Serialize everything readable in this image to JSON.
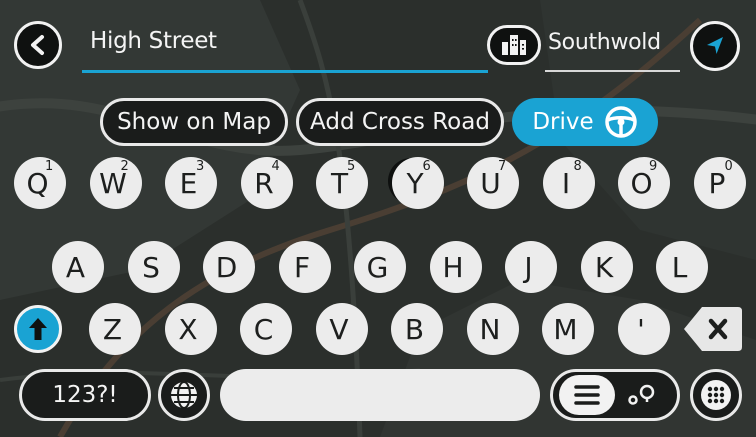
{
  "search": {
    "query": "High Street",
    "city": "Southwold"
  },
  "actions": {
    "show_on_map": "Show on Map",
    "add_cross_road": "Add Cross Road",
    "drive": "Drive"
  },
  "keyboard": {
    "row1": [
      {
        "char": "Q",
        "alt": "1"
      },
      {
        "char": "W",
        "alt": "2"
      },
      {
        "char": "E",
        "alt": "3"
      },
      {
        "char": "R",
        "alt": "4"
      },
      {
        "char": "T",
        "alt": "5"
      },
      {
        "char": "Y",
        "alt": "6"
      },
      {
        "char": "U",
        "alt": "7"
      },
      {
        "char": "I",
        "alt": "8"
      },
      {
        "char": "O",
        "alt": "9"
      },
      {
        "char": "P",
        "alt": "0"
      }
    ],
    "row2": [
      "A",
      "S",
      "D",
      "F",
      "G",
      "H",
      "J",
      "K",
      "L"
    ],
    "row3": [
      "Z",
      "X",
      "C",
      "V",
      "B",
      "N",
      "M",
      "'"
    ],
    "numbers_label": "123?!"
  },
  "colors": {
    "accent": "#1aa3d3",
    "key": "#ececec",
    "dark": "#1a1c1b"
  },
  "icons": {
    "back": "back-arrow-icon",
    "city": "city-buildings-icon",
    "location": "navigation-arrow-icon",
    "steering": "steering-wheel-icon",
    "shift": "shift-arrow-icon",
    "backspace": "backspace-icon",
    "globe": "globe-icon",
    "list_map": "list-map-toggle-icon",
    "keypad": "keypad-icon"
  }
}
